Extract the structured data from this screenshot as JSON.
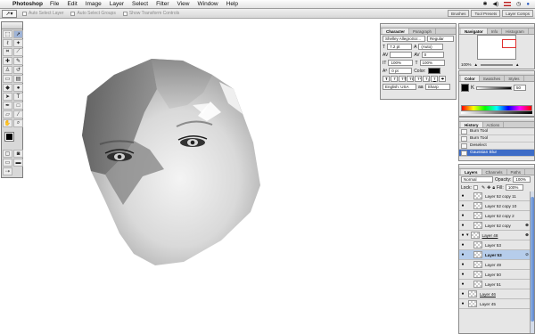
{
  "menubar": {
    "app": "Photoshop",
    "items": [
      "File",
      "Edit",
      "Image",
      "Layer",
      "Select",
      "Filter",
      "View",
      "Window",
      "Help"
    ]
  },
  "options_bar": {
    "auto_select_layer": "Auto Select Layer",
    "auto_select_groups": "Auto Select Groups",
    "show_transform": "Show Transform Controls",
    "wells": [
      "Brushes",
      "Tool Presets",
      "Layer Comps"
    ]
  },
  "character": {
    "tabs": [
      "Character",
      "Paragraph"
    ],
    "font": "Shelley AllegroScr...",
    "style": "Regular",
    "size": "7.2 pt",
    "leading": "(Auto)",
    "tracking": "0",
    "vscale": "100%",
    "hscale": "100%",
    "baseline": "0 pt",
    "color_label": "Color:",
    "language": "English: USA",
    "aa_label": "aa",
    "aa": "Sharp"
  },
  "navigator": {
    "tabs": [
      "Navigator",
      "Info",
      "Histogram"
    ],
    "zoom": "100%"
  },
  "color": {
    "tabs": [
      "Color",
      "Swatches",
      "Styles"
    ],
    "k_label": "K",
    "k_value": "50"
  },
  "history": {
    "tabs": [
      "History",
      "Actions"
    ],
    "items": [
      {
        "label": "Burn Tool",
        "sel": false
      },
      {
        "label": "Burn Tool",
        "sel": false
      },
      {
        "label": "Deselect",
        "sel": false
      },
      {
        "label": "Gaussian Blur",
        "sel": true
      }
    ]
  },
  "layers": {
    "tabs": [
      "Layers",
      "Channels",
      "Paths"
    ],
    "blend": "Normal",
    "opacity_label": "Opacity:",
    "opacity": "100%",
    "lock_label": "Lock:",
    "fill_label": "Fill:",
    "fill": "100%",
    "items": [
      {
        "name": "Layer 52 copy 11",
        "indent": true,
        "u": false,
        "sel": false
      },
      {
        "name": "Layer 52 copy 10",
        "indent": true,
        "u": false,
        "sel": false
      },
      {
        "name": "Layer 52 copy 2",
        "indent": true,
        "u": false,
        "sel": false
      },
      {
        "name": "Layer 52 copy",
        "indent": true,
        "u": false,
        "sel": false
      },
      {
        "name": "Layer 48",
        "indent": false,
        "u": true,
        "sel": false
      },
      {
        "name": "Layer 53",
        "indent": true,
        "u": false,
        "sel": false
      },
      {
        "name": "Layer 53",
        "indent": true,
        "u": false,
        "sel": true
      },
      {
        "name": "Layer 49",
        "indent": true,
        "u": false,
        "sel": false
      },
      {
        "name": "Layer 50",
        "indent": true,
        "u": false,
        "sel": false
      },
      {
        "name": "Layer 51",
        "indent": true,
        "u": false,
        "sel": false
      },
      {
        "name": "Layer 46",
        "indent": false,
        "u": true,
        "sel": false
      },
      {
        "name": "Layer 45",
        "indent": false,
        "u": false,
        "sel": false
      }
    ]
  },
  "colors": {
    "selected": "#3d6cc7",
    "layer_selected": "#b6cdeb"
  }
}
